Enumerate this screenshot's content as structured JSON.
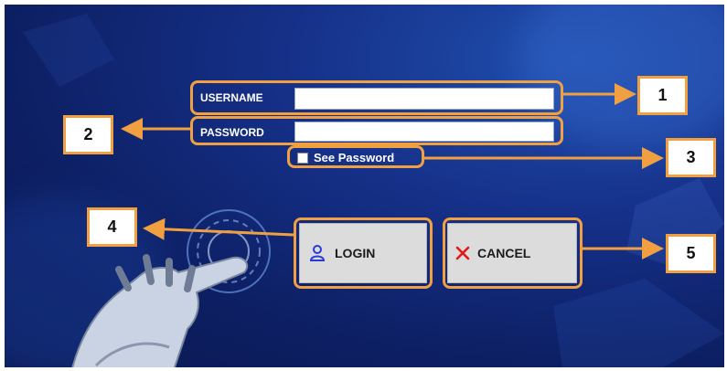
{
  "form": {
    "username_label": "USERNAME",
    "username_value": "",
    "password_label": "PASSWORD",
    "password_value": "",
    "see_password_label": "See Password",
    "see_password_checked": false
  },
  "buttons": {
    "login_label": "LOGIN",
    "login_icon": "user-icon",
    "cancel_label": "CANCEL",
    "cancel_icon": "close-x-icon"
  },
  "annotations": {
    "callouts": [
      "1",
      "2",
      "3",
      "4",
      "5"
    ],
    "accent_color": "#f0a040"
  },
  "colors": {
    "background_dark": "#0d1f63",
    "background_mid": "#16318a",
    "button_bg": "#dcdcdc",
    "cancel_icon_color": "#e11b1b",
    "login_icon_color": "#2a3ad6"
  }
}
